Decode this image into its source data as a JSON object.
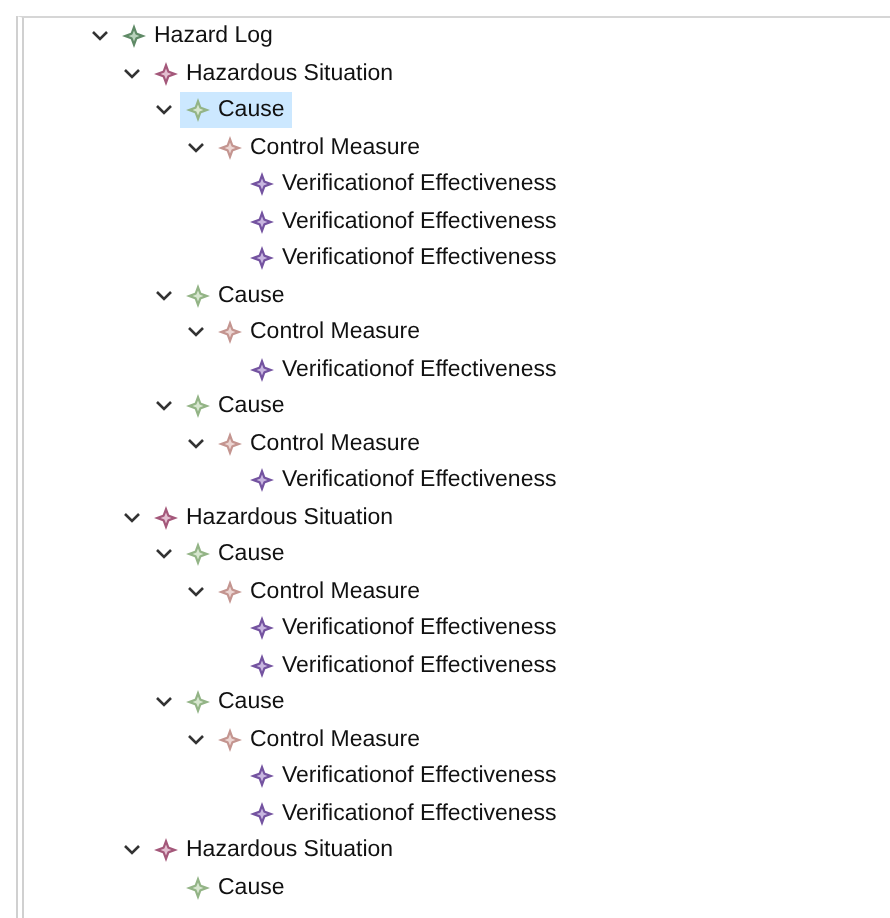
{
  "tree": [
    {
      "kind": "log",
      "label": "Hazard Log",
      "expanded": true,
      "selected": false,
      "children": [
        {
          "kind": "situation",
          "label": "Hazardous Situation",
          "expanded": true,
          "selected": false,
          "children": [
            {
              "kind": "cause",
              "label": "Cause",
              "expanded": true,
              "selected": true,
              "children": [
                {
                  "kind": "measure",
                  "label": "Control Measure",
                  "expanded": true,
                  "selected": false,
                  "children": [
                    {
                      "kind": "verification",
                      "label": "Verificationof Effectiveness",
                      "selected": false
                    },
                    {
                      "kind": "verification",
                      "label": "Verificationof Effectiveness",
                      "selected": false
                    },
                    {
                      "kind": "verification",
                      "label": "Verificationof Effectiveness",
                      "selected": false
                    }
                  ]
                }
              ]
            },
            {
              "kind": "cause",
              "label": "Cause",
              "expanded": true,
              "selected": false,
              "children": [
                {
                  "kind": "measure",
                  "label": "Control Measure",
                  "expanded": true,
                  "selected": false,
                  "children": [
                    {
                      "kind": "verification",
                      "label": "Verificationof Effectiveness",
                      "selected": false
                    }
                  ]
                }
              ]
            },
            {
              "kind": "cause",
              "label": "Cause",
              "expanded": true,
              "selected": false,
              "children": [
                {
                  "kind": "measure",
                  "label": "Control Measure",
                  "expanded": true,
                  "selected": false,
                  "children": [
                    {
                      "kind": "verification",
                      "label": "Verificationof Effectiveness",
                      "selected": false
                    }
                  ]
                }
              ]
            }
          ]
        },
        {
          "kind": "situation",
          "label": "Hazardous Situation",
          "expanded": true,
          "selected": false,
          "children": [
            {
              "kind": "cause",
              "label": "Cause",
              "expanded": true,
              "selected": false,
              "children": [
                {
                  "kind": "measure",
                  "label": "Control Measure",
                  "expanded": true,
                  "selected": false,
                  "children": [
                    {
                      "kind": "verification",
                      "label": "Verificationof Effectiveness",
                      "selected": false
                    },
                    {
                      "kind": "verification",
                      "label": "Verificationof Effectiveness",
                      "selected": false
                    }
                  ]
                }
              ]
            },
            {
              "kind": "cause",
              "label": "Cause",
              "expanded": true,
              "selected": false,
              "children": [
                {
                  "kind": "measure",
                  "label": "Control Measure",
                  "expanded": true,
                  "selected": false,
                  "children": [
                    {
                      "kind": "verification",
                      "label": "Verificationof Effectiveness",
                      "selected": false
                    },
                    {
                      "kind": "verification",
                      "label": "Verificationof Effectiveness",
                      "selected": false
                    }
                  ]
                }
              ]
            }
          ]
        },
        {
          "kind": "situation",
          "label": "Hazardous Situation",
          "expanded": true,
          "selected": false,
          "children": [
            {
              "kind": "cause",
              "label": "Cause",
              "selected": false
            }
          ]
        }
      ]
    }
  ]
}
